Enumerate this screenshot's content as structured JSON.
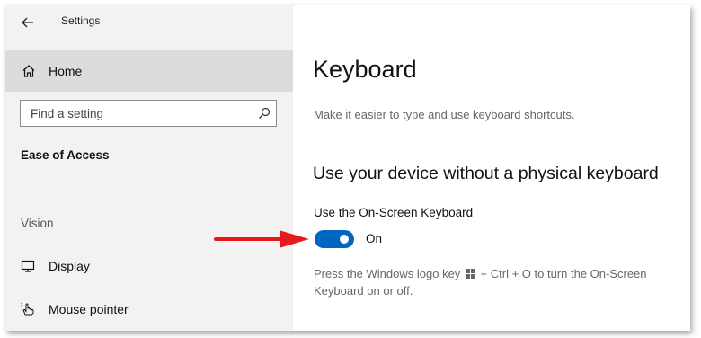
{
  "app": {
    "title": "Settings"
  },
  "sidebar": {
    "home_label": "Home",
    "search": {
      "placeholder": "Find a setting"
    },
    "section_header": "Ease of Access",
    "group_label": "Vision",
    "items": [
      {
        "label": "Display",
        "icon": "display-icon"
      },
      {
        "label": "Mouse pointer",
        "icon": "mouse-pointer-icon"
      }
    ]
  },
  "main": {
    "title": "Keyboard",
    "subtitle": "Make it easier to type and use keyboard shortcuts.",
    "section_title": "Use your device without a physical keyboard",
    "setting": {
      "label": "Use the On-Screen Keyboard",
      "state": "On",
      "enabled": true
    },
    "help": {
      "before_icon": "Press the Windows logo key",
      "icon": "windows-logo-icon",
      "after_icon": "+ Ctrl + O to turn the On-Screen Keyboard on or off."
    }
  },
  "colors": {
    "accent": "#0067c0",
    "annotation_arrow": "#e8191b",
    "sidebar_bg": "#f2f2f2",
    "selected_item_bg": "#dcdcdc"
  }
}
